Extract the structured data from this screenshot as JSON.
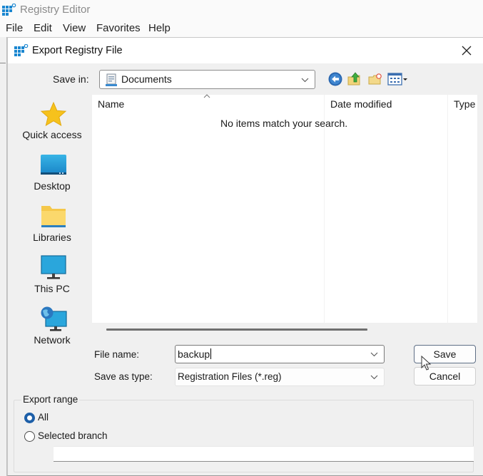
{
  "parent_window": {
    "title": "Registry Editor",
    "menu": [
      "File",
      "Edit",
      "View",
      "Favorites",
      "Help"
    ]
  },
  "dialog": {
    "title": "Export Registry File",
    "save_in": {
      "label": "Save in:",
      "value": "Documents"
    },
    "toolbar": [
      {
        "name": "back",
        "icon": "back-arrow-icon"
      },
      {
        "name": "up-one-level",
        "icon": "folder-up-icon"
      },
      {
        "name": "new-folder",
        "icon": "new-folder-icon"
      },
      {
        "name": "view-menu",
        "icon": "view-menu-icon"
      }
    ],
    "places": [
      {
        "label": "Quick access",
        "icon": "star-icon"
      },
      {
        "label": "Desktop",
        "icon": "desktop-icon"
      },
      {
        "label": "Libraries",
        "icon": "folder-icon"
      },
      {
        "label": "This PC",
        "icon": "monitor-icon"
      },
      {
        "label": "Network",
        "icon": "network-icon"
      }
    ],
    "file_list": {
      "columns": [
        "Name",
        "Date modified",
        "Type"
      ],
      "sorted_column": "Name",
      "empty_message": "No items match your search."
    },
    "file_name": {
      "label": "File name:",
      "value": "backup"
    },
    "save_as_type": {
      "label": "Save as type:",
      "value": "Registration Files (*.reg)"
    },
    "buttons": {
      "save": "Save",
      "cancel": "Cancel"
    },
    "export_range": {
      "legend": "Export range",
      "options": [
        {
          "label": "All",
          "selected": true
        },
        {
          "label": "Selected branch",
          "selected": false
        }
      ],
      "branch_value": ""
    }
  },
  "colors": {
    "accent": "#1d5fa8",
    "dialog_bg": "#f0f0f0",
    "list_bg": "#ffffff"
  }
}
